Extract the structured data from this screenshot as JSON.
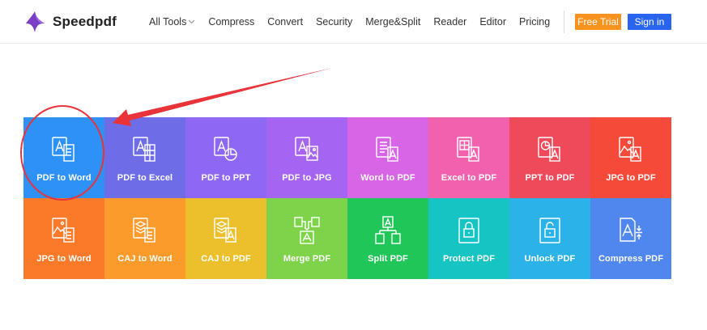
{
  "header": {
    "brand": "Speedpdf",
    "nav": [
      {
        "label": "All Tools",
        "has_dropdown": true
      },
      {
        "label": "Compress"
      },
      {
        "label": "Convert"
      },
      {
        "label": "Security"
      },
      {
        "label": "Merge&Split"
      },
      {
        "label": "Reader"
      },
      {
        "label": "Editor"
      }
    ],
    "pricing": "Pricing",
    "free_trial": "Free Trial",
    "sign_in": "Sign in"
  },
  "colors": {
    "accent_orange": "#f7931e",
    "accent_blue": "#2864ed",
    "annotation_red": "#e8333a"
  },
  "tools": [
    {
      "label": "PDF to Word",
      "color": "#2d91f5",
      "icon": "pdf-to-word-icon"
    },
    {
      "label": "PDF to Excel",
      "color": "#6f6ce8",
      "icon": "pdf-to-excel-icon"
    },
    {
      "label": "PDF to PPT",
      "color": "#8e67f4",
      "icon": "pdf-to-ppt-icon"
    },
    {
      "label": "PDF to JPG",
      "color": "#a564f2",
      "icon": "pdf-to-jpg-icon"
    },
    {
      "label": "Word to PDF",
      "color": "#d765e6",
      "icon": "word-to-pdf-icon"
    },
    {
      "label": "Excel to PDF",
      "color": "#f261ad",
      "icon": "excel-to-pdf-icon"
    },
    {
      "label": "PPT to PDF",
      "color": "#ef4a5a",
      "icon": "ppt-to-pdf-icon"
    },
    {
      "label": "JPG to PDF",
      "color": "#f5493a",
      "icon": "jpg-to-pdf-icon"
    },
    {
      "label": "JPG to Word",
      "color": "#fb7a2a",
      "icon": "jpg-to-word-icon"
    },
    {
      "label": "CAJ to Word",
      "color": "#fb9b2b",
      "icon": "caj-to-word-icon"
    },
    {
      "label": "CAJ to PDF",
      "color": "#ecc02c",
      "icon": "caj-to-pdf-icon"
    },
    {
      "label": "Merge PDF",
      "color": "#7ed34a",
      "icon": "merge-pdf-icon"
    },
    {
      "label": "Split PDF",
      "color": "#20c657",
      "icon": "split-pdf-icon"
    },
    {
      "label": "Protect PDF",
      "color": "#16c4c4",
      "icon": "protect-pdf-icon"
    },
    {
      "label": "Unlock PDF",
      "color": "#2bb2e6",
      "icon": "unlock-pdf-icon"
    },
    {
      "label": "Compress PDF",
      "color": "#4f87ef",
      "icon": "compress-pdf-icon"
    }
  ]
}
